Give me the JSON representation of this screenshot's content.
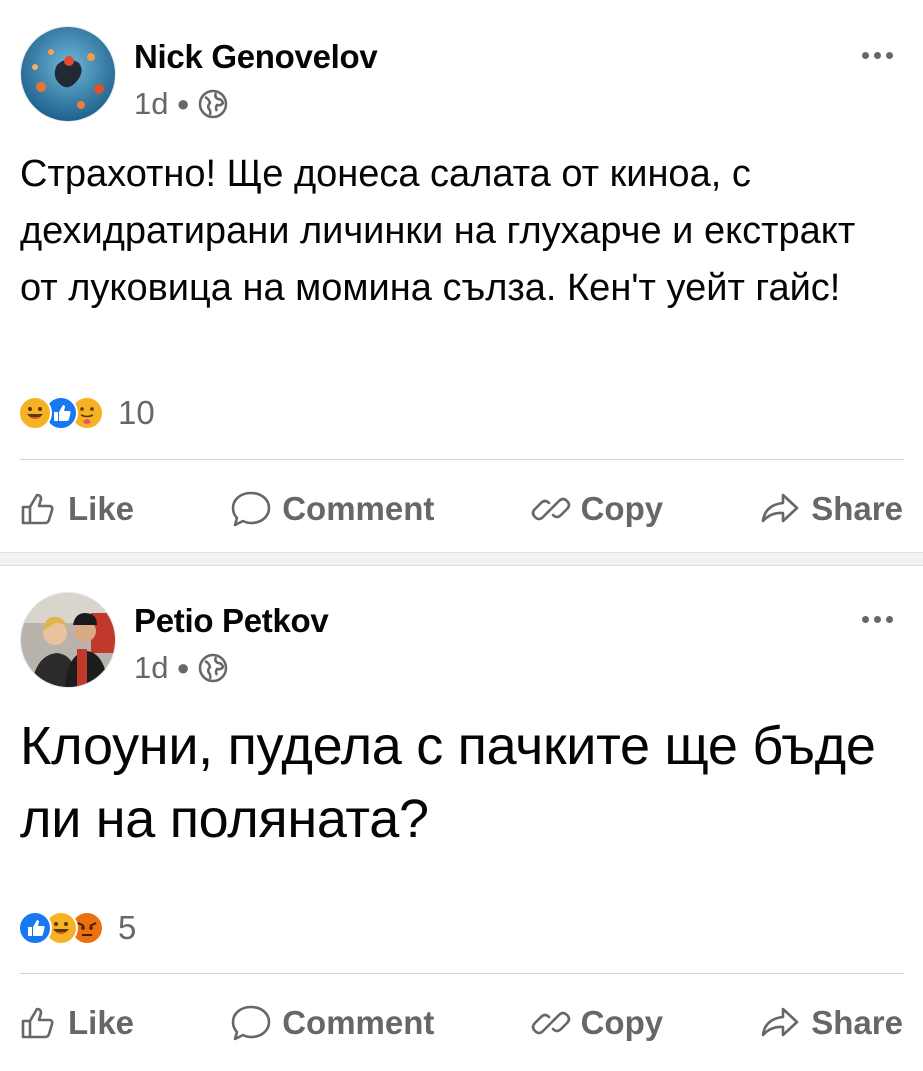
{
  "posts": [
    {
      "author": "Nick Genovelov",
      "time": "1d",
      "audience_icon": "globe-icon",
      "text": "Страхотно! Ще донеса салата от киноа, с дехидратирани личинки на глухарче и екстракт от луковица на момина сълза. Кен'т уейт гайс!",
      "reactions": [
        "haha",
        "like",
        "care"
      ],
      "reaction_count": "10"
    },
    {
      "author": "Petio Petkov",
      "time": "1d",
      "audience_icon": "globe-icon",
      "text": "Клоуни, пудела с пачките ще бъде ли на поляната?",
      "reactions": [
        "like",
        "haha",
        "angry"
      ],
      "reaction_count": "5"
    }
  ],
  "actions": {
    "like": "Like",
    "comment": "Comment",
    "copy": "Copy",
    "share": "Share"
  },
  "colors": {
    "secondary_text": "#65676b",
    "like_blue": "#1877f2",
    "reaction_yellow": "#f7b125",
    "angry_red": "#e9710f"
  }
}
